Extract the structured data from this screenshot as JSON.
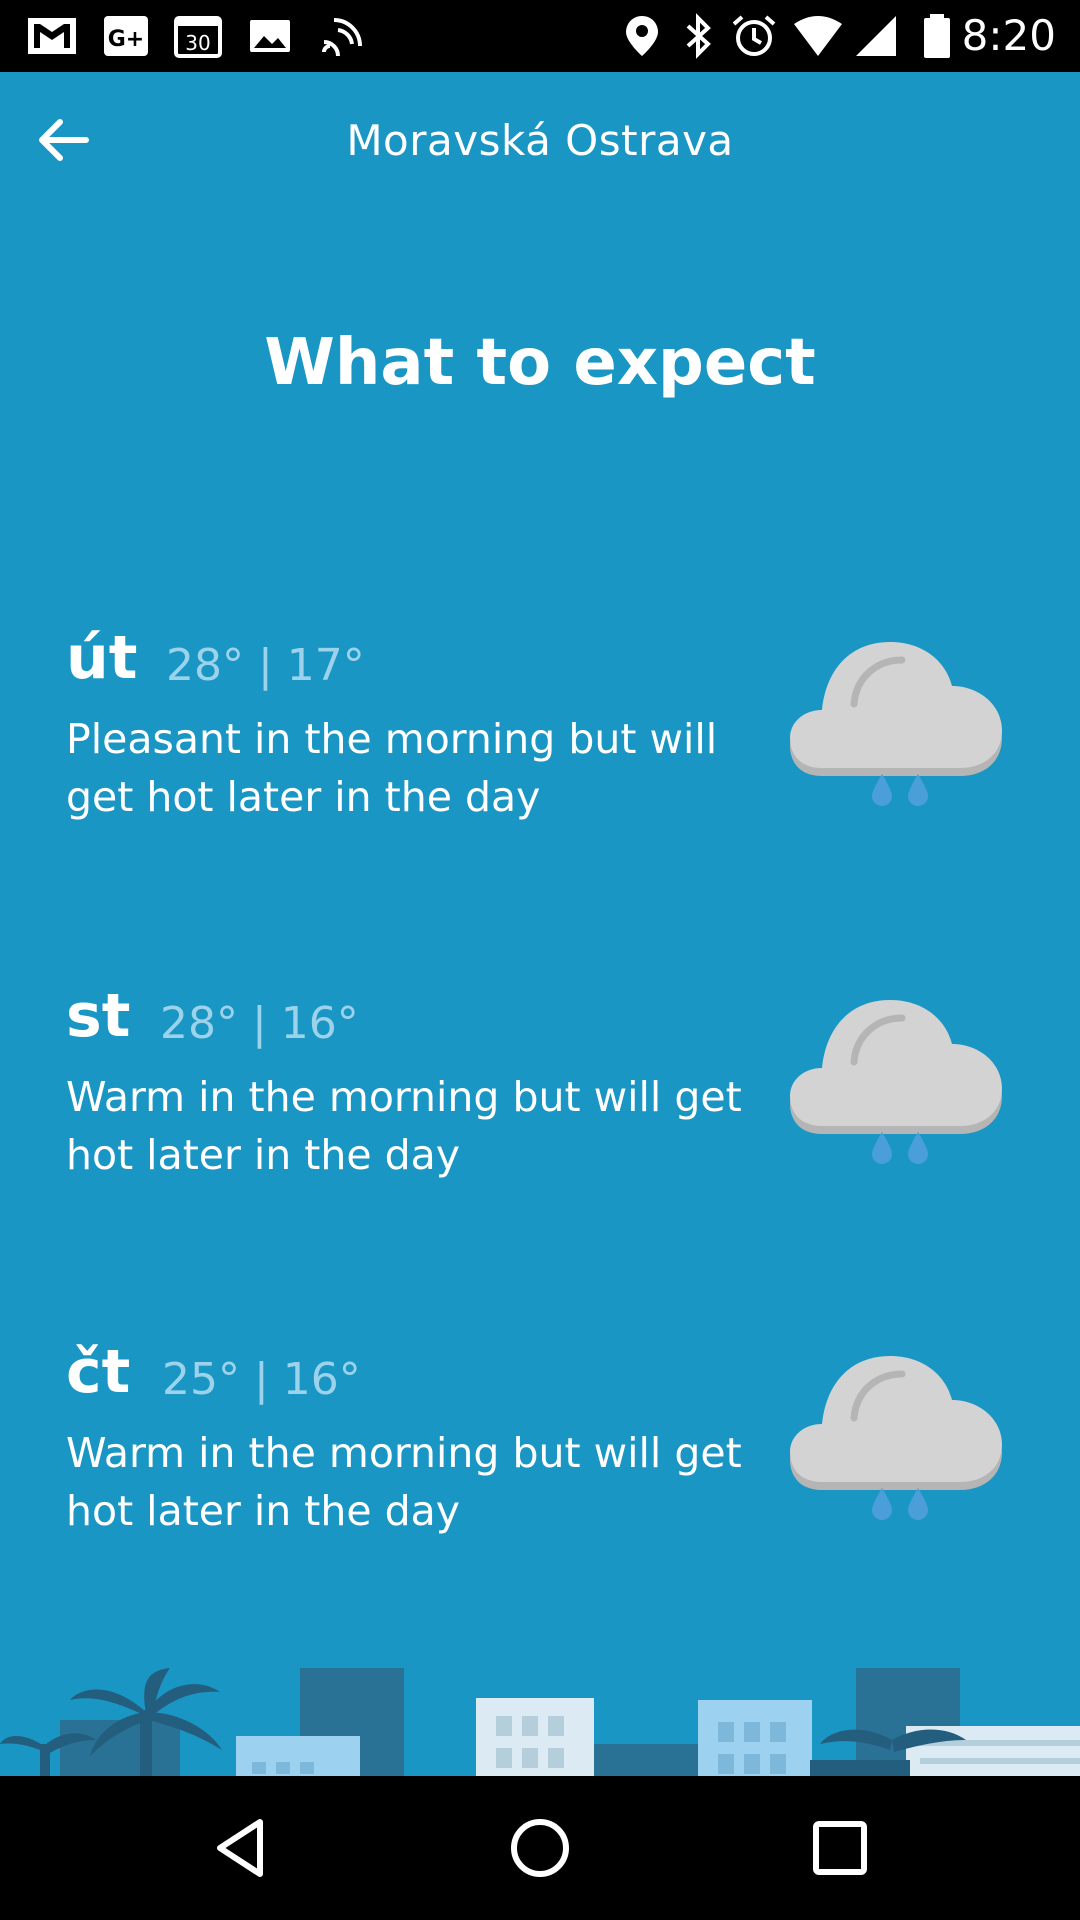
{
  "status_bar": {
    "time": "8:20",
    "left_icons": [
      "gmail-icon",
      "google-plus-icon",
      "calendar-icon",
      "gallery-icon",
      "cast-icon"
    ],
    "right_icons": [
      "location-icon",
      "bluetooth-icon",
      "alarm-icon",
      "wifi-icon",
      "signal-icon",
      "battery-icon"
    ]
  },
  "header": {
    "back_icon": "arrow-left-icon",
    "title": "Moravská Ostrava"
  },
  "headline": "What to expect",
  "days": [
    {
      "name": "út",
      "temps": "28° | 17°",
      "description": "Pleasant in the morning but will get hot later in the day",
      "icon": "rain-cloud-icon"
    },
    {
      "name": "st",
      "temps": "28° | 16°",
      "description": "Warm in the morning but will get hot later in the day",
      "icon": "rain-cloud-icon"
    },
    {
      "name": "čt",
      "temps": "25° | 16°",
      "description": "Warm in the morning but will get hot later in the day",
      "icon": "rain-cloud-icon"
    }
  ],
  "nav_bar": {
    "icons": [
      "back-triangle-icon",
      "home-circle-icon",
      "recents-square-icon"
    ]
  },
  "colors": {
    "background": "#1A96C4",
    "temps": "#9CD3EA",
    "cloud": "#D3D3D3",
    "drop": "#4A9FD8"
  }
}
